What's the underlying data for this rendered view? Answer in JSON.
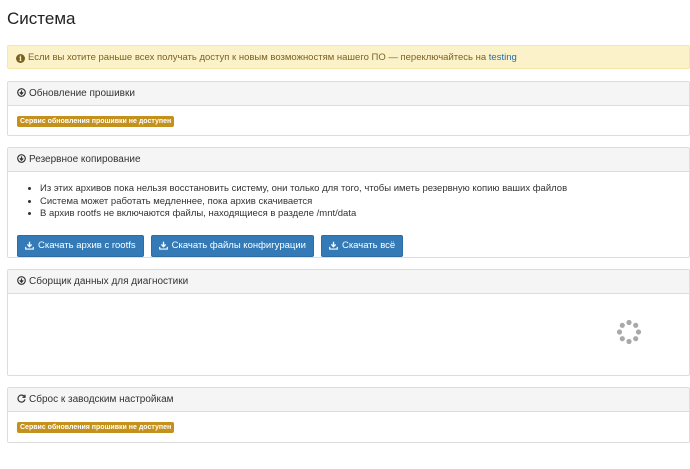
{
  "page": {
    "title": "Система"
  },
  "alert": {
    "icon": "info-circle-icon",
    "text": "Если вы хотите раньше всех получать доступ к новым возможностям нашего ПО — переключайтесь на",
    "link": "testing",
    "colors": {
      "background": "#fcf2c9",
      "text": "#7a6224",
      "link": "#2a6aa8"
    }
  },
  "firmware": {
    "icon": "arrow-circle-down-icon",
    "title": "Обновление прошивки",
    "status_badge": "Сервис обновления прошивки не доступен"
  },
  "backup": {
    "icon": "arrow-circle-down-icon",
    "title": "Резервное копирование",
    "notes": [
      "Из этих архивов пока нельзя восстановить систему, они только для того, чтобы иметь резервную копию ваших файлов",
      "Система может работать медленнее, пока архив скачивается",
      "В архив rootfs не включаются файлы, находящиеся в разделе /mnt/data"
    ],
    "buttons": [
      {
        "icon": "download-icon",
        "label": "Скачать архив с rootfs"
      },
      {
        "icon": "download-icon",
        "label": "Скачать файлы конфигурации"
      },
      {
        "icon": "download-icon",
        "label": "Скачать всё"
      }
    ],
    "button_color": "#337ab7"
  },
  "diagnostics": {
    "icon": "arrow-circle-down-icon",
    "title": "Сборщик данных для диагностики",
    "loading_icon": "spinner-icon"
  },
  "factory_reset": {
    "icon": "refresh-icon",
    "title": "Сброс к заводским настройкам",
    "status_badge": "Сервис обновления прошивки не доступен"
  },
  "colors": {
    "badge": "#c4911c",
    "panel_heading": "#f5f5f5",
    "border": "#dddddd"
  }
}
